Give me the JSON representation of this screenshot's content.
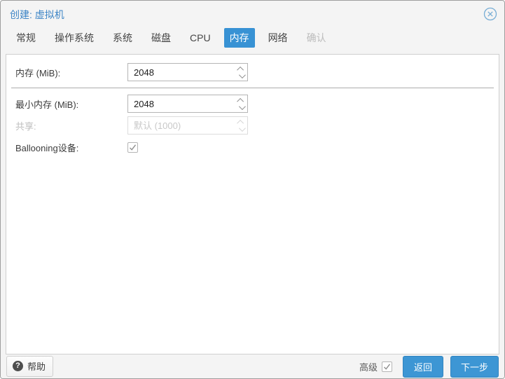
{
  "window": {
    "title": "创建: 虚拟机"
  },
  "tabs": [
    {
      "label": "常规",
      "state": "normal"
    },
    {
      "label": "操作系统",
      "state": "normal"
    },
    {
      "label": "系统",
      "state": "normal"
    },
    {
      "label": "磁盘",
      "state": "normal"
    },
    {
      "label": "CPU",
      "state": "normal"
    },
    {
      "label": "内存",
      "state": "active"
    },
    {
      "label": "网络",
      "state": "normal"
    },
    {
      "label": "确认",
      "state": "disabled"
    }
  ],
  "form": {
    "fields": [
      {
        "label": "内存 (MiB):",
        "type": "spinner",
        "value": "2048",
        "enabled": true
      },
      {
        "label": "最小内存 (MiB):",
        "type": "spinner",
        "value": "2048",
        "enabled": true
      },
      {
        "label": "共享:",
        "type": "spinner",
        "placeholder": "默认 (1000)",
        "enabled": false
      },
      {
        "label": "Ballooning设备:",
        "type": "checkbox",
        "checked": true,
        "enabled": true
      }
    ]
  },
  "footer": {
    "help_label": "帮助",
    "advanced_label": "高级",
    "advanced_checked": true,
    "back_label": "返回",
    "next_label": "下一步"
  },
  "colors": {
    "accent_blue": "#3892d4",
    "title_blue": "#3d85c6",
    "close_icon_blue": "#77add5",
    "disabled_text": "#bdbdbd",
    "check_gray": "#8f8f8f",
    "body_bg": "#ffffff",
    "frame_bg": "#f4f4f4"
  }
}
